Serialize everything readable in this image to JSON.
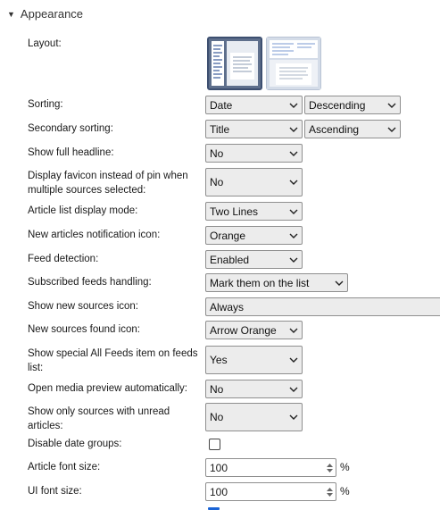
{
  "section": {
    "title": "Appearance"
  },
  "settings": {
    "layout": {
      "label": "Layout:"
    },
    "sorting": {
      "label": "Sorting:",
      "value": "Date",
      "value2": "Descending"
    },
    "secondary_sorting": {
      "label": "Secondary sorting:",
      "value": "Title",
      "value2": "Ascending"
    },
    "show_full_headline": {
      "label": "Show full headline:",
      "value": "No"
    },
    "display_favicon": {
      "label_line1": "Display favicon instead of pin when",
      "label_line2": "multiple sources selected:",
      "value": "No"
    },
    "article_list_mode": {
      "label": "Article list display mode:",
      "value": "Two Lines"
    },
    "new_articles_icon": {
      "label": "New articles notification icon:",
      "value": "Orange"
    },
    "feed_detection": {
      "label": "Feed detection:",
      "value": "Enabled"
    },
    "subscribed_feeds": {
      "label": "Subscribed feeds handling:",
      "value": "Mark them on the list"
    },
    "show_new_sources_icon": {
      "label": "Show new sources icon:",
      "value": "Always"
    },
    "new_sources_found_icon": {
      "label": "New sources found icon:",
      "value": "Arrow Orange"
    },
    "show_all_feeds": {
      "label_line1": "Show special All Feeds item on feeds",
      "label_line2": "list:",
      "value": "Yes"
    },
    "open_media_preview": {
      "label": "Open media preview automatically:",
      "value": "No"
    },
    "show_unread_only": {
      "label_line1": "Show only sources with unread",
      "label_line2": "articles:",
      "value": "No"
    },
    "disable_date_groups": {
      "label": "Disable date groups:",
      "checked": false
    },
    "article_font_size": {
      "label": "Article font size:",
      "value": "100",
      "unit": "%"
    },
    "ui_font_size": {
      "label": "UI font size:",
      "value": "100",
      "unit": "%"
    }
  }
}
